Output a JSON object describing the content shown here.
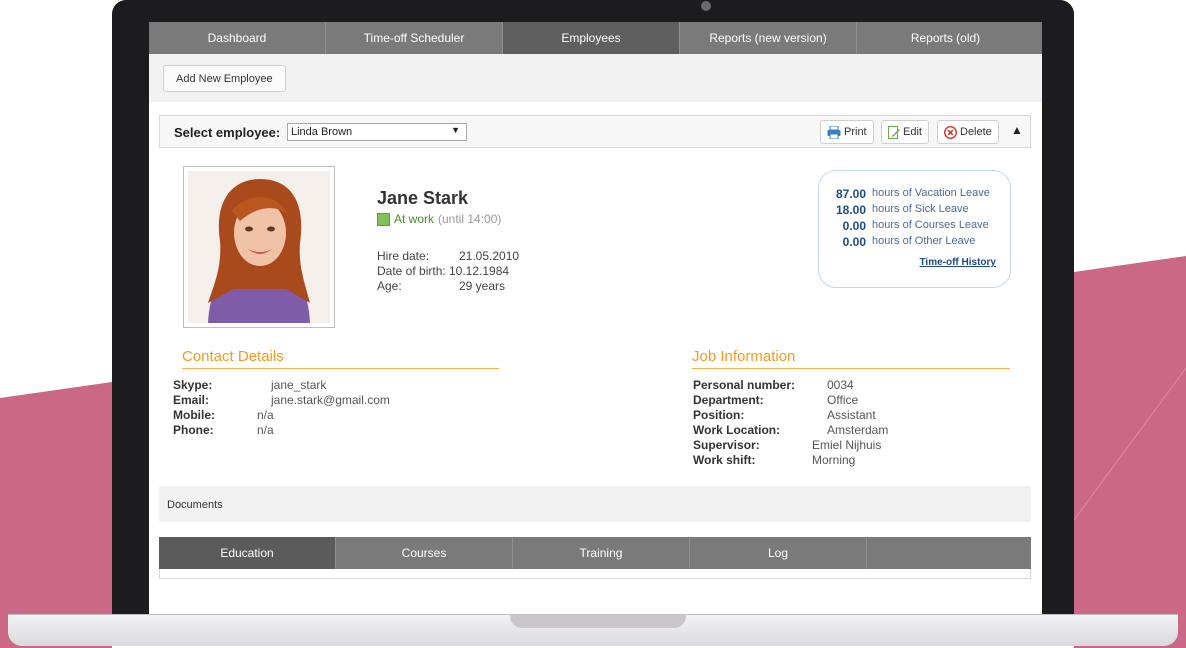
{
  "colors": {
    "accent_pink": "#cb6886",
    "nav_gray": "#7a7a7a",
    "section_orange": "#f29b1d",
    "leave_blue": "#1f4a86",
    "status_green": "#7ec35a"
  },
  "topnav": {
    "tabs": [
      {
        "label": "Dashboard"
      },
      {
        "label": "Time-off Scheduler"
      },
      {
        "label": "Employees",
        "active": true
      },
      {
        "label": "Reports (new version)"
      },
      {
        "label": "Reports (old)"
      }
    ]
  },
  "toolbar": {
    "add_label": "Add New Employee"
  },
  "selector": {
    "label": "Select employee:",
    "value": "Linda Brown",
    "print_label": "Print",
    "edit_label": "Edit",
    "delete_label": "Delete"
  },
  "employee": {
    "name": "Jane Stark",
    "status": "At work",
    "status_until": "(until 14:00)",
    "hire_label": "Hire date:",
    "hire_date": "21.05.2010",
    "dob_label": "Date of birth:",
    "dob": "10.12.1984",
    "age_label": "Age:",
    "age": "29 years"
  },
  "leave": {
    "rows": [
      {
        "value": "87.00",
        "text": "hours of Vacation Leave"
      },
      {
        "value": "18.00",
        "text": "hours of Sick Leave"
      },
      {
        "value": "0.00",
        "text": "hours of Courses Leave"
      },
      {
        "value": "0.00",
        "text": "hours of Other Leave"
      }
    ],
    "history_link": "Time-off History"
  },
  "contact": {
    "title": "Contact Details",
    "rows": [
      {
        "key": "Skype:",
        "value": "jane_stark"
      },
      {
        "key": "Email:",
        "value": "jane.stark@gmail.com"
      },
      {
        "key": "Mobile:",
        "value": "n/a"
      },
      {
        "key": "Phone:",
        "value": "n/a"
      }
    ]
  },
  "job": {
    "title": "Job Information",
    "rows": [
      {
        "key": "Personal number:",
        "value": "0034"
      },
      {
        "key": "Department:",
        "value": "Office"
      },
      {
        "key": "Position:",
        "value": "Assistant"
      },
      {
        "key": "Work Location:",
        "value": "Amsterdam"
      },
      {
        "key": "Supervisor:",
        "value": "Emiel Nijhuis"
      },
      {
        "key": "Work shift:",
        "value": "Morning"
      }
    ]
  },
  "documents": {
    "label": "Documents"
  },
  "bottom_tabs": [
    {
      "label": "Education",
      "active": true
    },
    {
      "label": "Courses"
    },
    {
      "label": "Training"
    },
    {
      "label": "Log"
    },
    {
      "label": ""
    }
  ]
}
